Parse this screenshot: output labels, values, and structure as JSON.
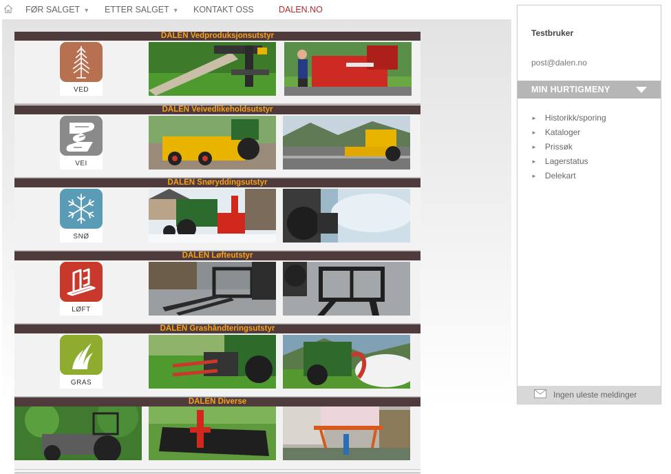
{
  "nav": {
    "home_icon": "home-icon",
    "items": [
      {
        "label": "FØR SALGET",
        "has_dropdown": true
      },
      {
        "label": "ETTER SALGET",
        "has_dropdown": true
      },
      {
        "label": "KONTAKT OSS",
        "has_dropdown": false
      },
      {
        "label": "DALEN.NO",
        "has_dropdown": false
      }
    ],
    "dropdown_glyph": "▼"
  },
  "sections": [
    {
      "title": "DALEN Vedproduksjonsutstyr",
      "logo_label": "VED",
      "logo_color": "#b87150",
      "logo_icon": "tree-icon"
    },
    {
      "title": "DALEN Veivedlikeholdsutstyr",
      "logo_label": "VEI",
      "logo_color": "#8a8a8a",
      "logo_icon": "road-icon"
    },
    {
      "title": "DALEN Snøryddingsutstyr",
      "logo_label": "SNØ",
      "logo_color": "#5a9bb5",
      "logo_icon": "snowflake-icon"
    },
    {
      "title": "DALEN Løfteutstyr",
      "logo_label": "LØFT",
      "logo_color": "#c8392b",
      "logo_icon": "pallet-fork-icon"
    },
    {
      "title": "DALEN Grashåndteringsutstyr",
      "logo_label": "GRAS",
      "logo_color": "#8fac2e",
      "logo_icon": "grass-icon"
    },
    {
      "title": "DALEN Diverse",
      "logo_label": "",
      "logo_color": "",
      "logo_icon": ""
    }
  ],
  "sidebar": {
    "username": "Testbruker",
    "email": "post@dalen.no",
    "quickmenu_title": "MIN HURTIGMENY",
    "quickmenu_items": [
      "Historikk/sporing",
      "Kataloger",
      "Prissøk",
      "Lagerstatus",
      "Delekart"
    ],
    "bullet": "►",
    "messages": "Ingen uleste meldinger",
    "messages_icon": "envelope-icon"
  },
  "colors": {
    "section_bar": "#503b3c",
    "section_title": "#f6a21f",
    "brand_link": "#b22a2a",
    "quickmenu_bg": "#b6b6b6"
  }
}
